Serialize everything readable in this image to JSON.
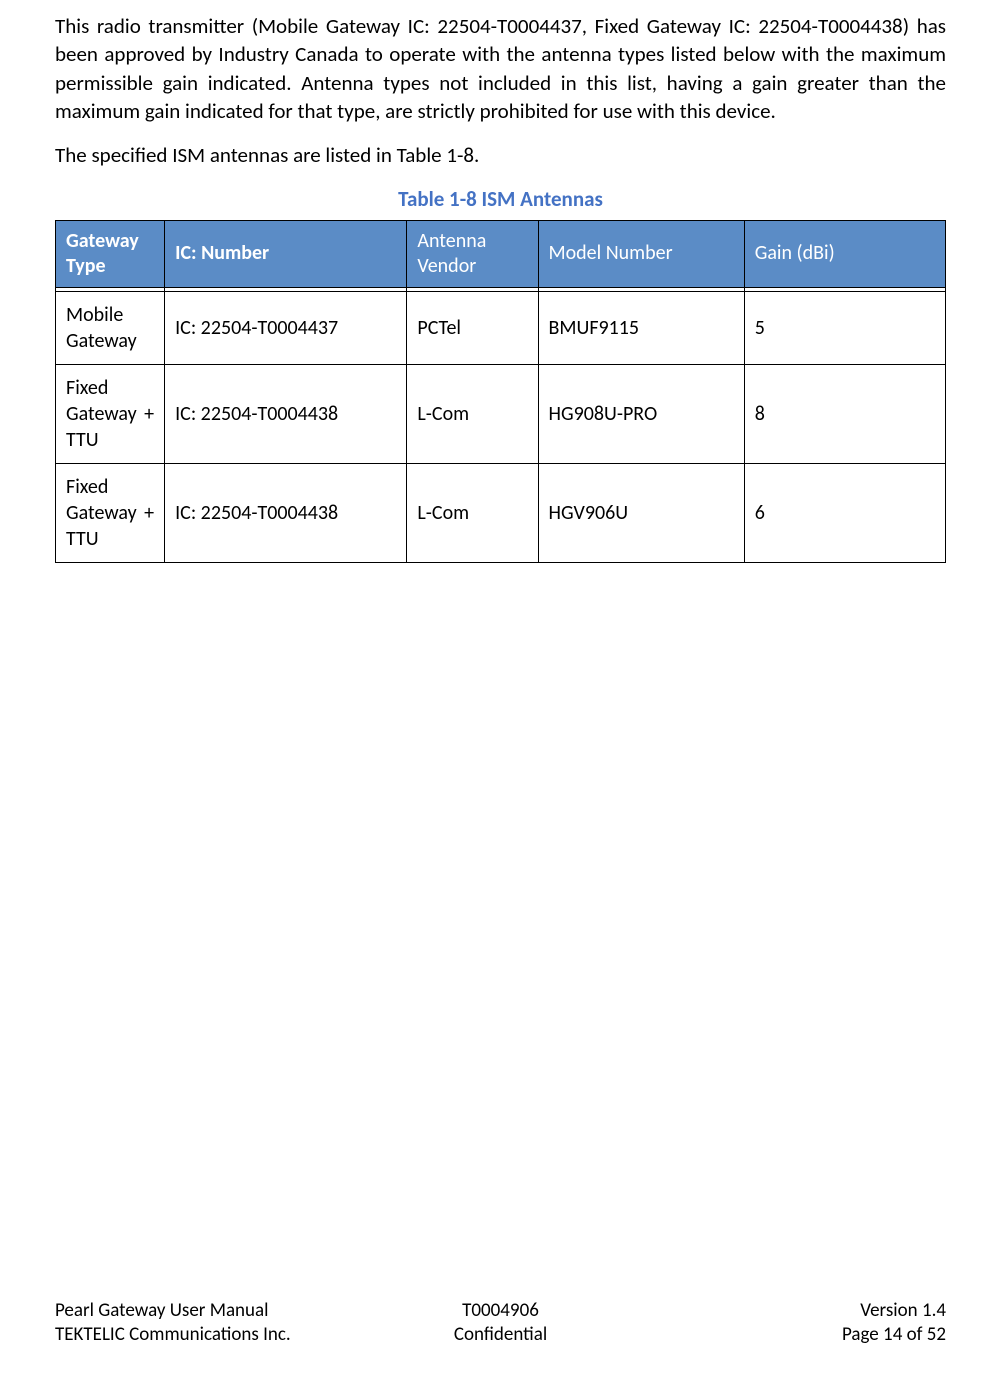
{
  "body": {
    "p1": "This radio transmitter (Mobile Gateway  IC: 22504-T0004437, Fixed Gateway IC: 22504-T0004438) has been approved by Industry Canada to operate with the antenna types listed below with the maximum permissible gain indicated. Antenna types not included in this list, having a gain greater than the maximum gain indicated for that type, are strictly prohibited for use with this device.",
    "p2": "The specified ISM antennas are listed in Table 1-8."
  },
  "table": {
    "caption": "Table 1-8 ISM Antennas",
    "headers": {
      "gateway_type": "Gateway Type",
      "ic_number": "IC: Number",
      "vendor": "Antenna Vendor",
      "model": "Model Number",
      "gain": "Gain (dBi)"
    },
    "rows": [
      {
        "gateway_type": "Mobile Gateway",
        "ic_number": "IC: 22504-T0004437",
        "vendor": "PCTel",
        "model": "BMUF9115",
        "gain": "5"
      },
      {
        "gateway_type": "Fixed Gateway + TTU",
        "ic_number": "IC: 22504-T0004438",
        "vendor": "L-Com",
        "model": "HG908U-PRO",
        "gain": "8"
      },
      {
        "gateway_type": "Fixed Gateway + TTU",
        "ic_number": "IC: 22504-T0004438",
        "vendor": "L-Com",
        "model": "HGV906U",
        "gain": "6"
      }
    ]
  },
  "footer": {
    "left1": "Pearl Gateway User Manual",
    "mid1": "T0004906",
    "right1": "Version 1.4",
    "left2": "TEKTELIC Communications Inc.",
    "mid2": "Confidential",
    "right2": "Page 14 of 52"
  }
}
